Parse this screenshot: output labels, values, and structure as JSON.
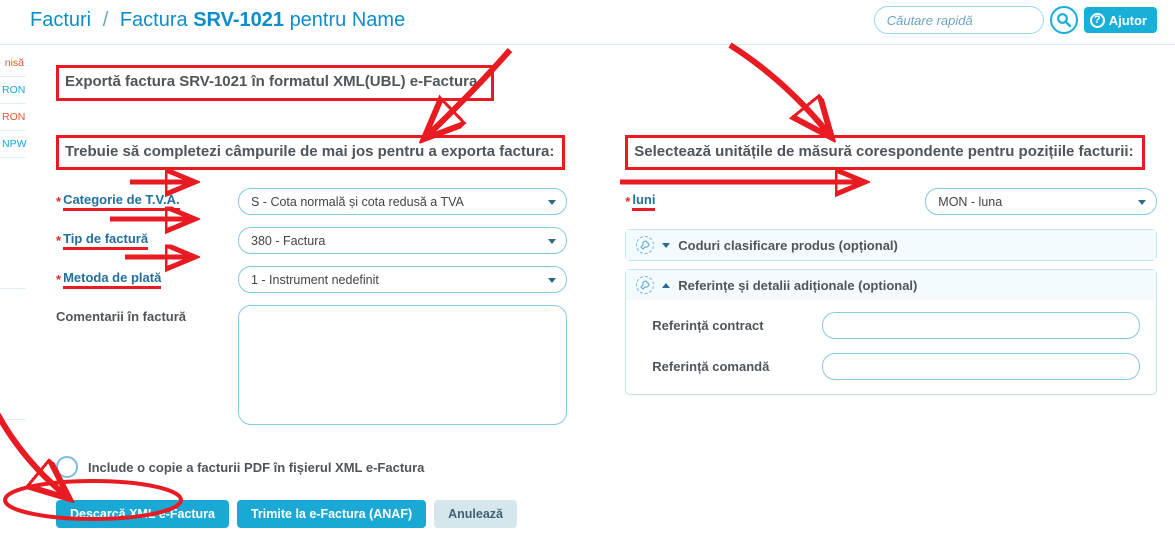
{
  "breadcrumb": {
    "list_label": "Facturi",
    "sep": "/",
    "detail_prefix": "Factura",
    "invoice_no": "SRV-1021",
    "for_word": "pentru",
    "customer": "Name"
  },
  "topbar": {
    "search_placeholder": "Căutare rapidă",
    "help_label": "Ajutor"
  },
  "sidenav": {
    "items": [
      "nisă",
      "RON",
      "RON",
      "NPW"
    ]
  },
  "export_title": "Exportă factura SRV-1021 în formatul XML(UBL) e-Factura.",
  "left_section_title": "Trebuie să completezi câmpurile de mai jos pentru a exporta factura:",
  "fields": {
    "vat_category": {
      "label": "Categorie de T.V.A.",
      "value": "S - Cota normală și cota redusă a TVA"
    },
    "invoice_type": {
      "label": "Tip de factură",
      "value": "380 - Factura"
    },
    "payment_method": {
      "label": "Metoda de plată",
      "value": "1 - Instrument nedefinit"
    },
    "comments": {
      "label": "Comentarii în factură",
      "value": ""
    }
  },
  "right_section_title": "Selectează unitățile de măsură corespondente pentru pozițiile facturii:",
  "uom": {
    "label": "luni",
    "value": "MON - luna"
  },
  "panel_codes": {
    "title": "Coduri clasificare produs (opțional)"
  },
  "panel_refs": {
    "title": "Referințe și detalii adiționale (optional)",
    "contract_label": "Referință contract",
    "contract_value": "",
    "order_label": "Referință comandă",
    "order_value": ""
  },
  "checkbox_label": "Include o copie a facturii PDF în fișierul XML e-Factura",
  "buttons": {
    "download": "Descarcă XML e-Factura",
    "send": "Trimite la e-Factura (ANAF)",
    "cancel": "Anulează"
  }
}
